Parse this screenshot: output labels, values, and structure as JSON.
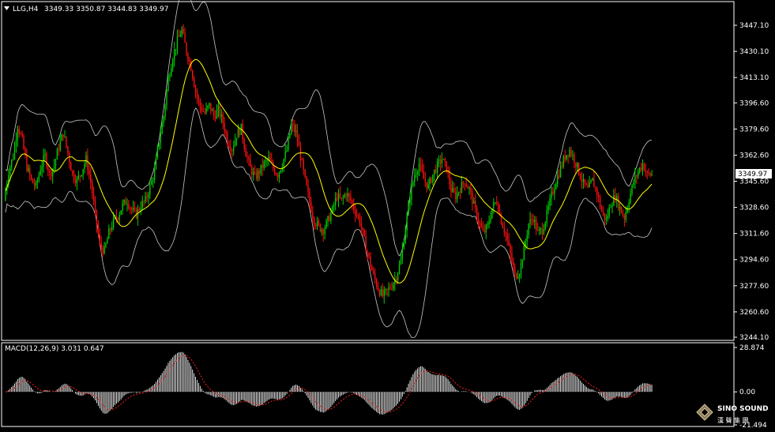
{
  "window": {
    "symbol_label": "LLG,H4",
    "ohlc_label": "3349.33 3350.87 3344.83 3349.97",
    "dropdown_icon": "triangle-down-icon"
  },
  "colors": {
    "background": "#000000",
    "frame": "#ffffff",
    "grid": "#7a7a7a",
    "bull": "#00d000",
    "bear": "#ff1010",
    "ma": "#ffff00",
    "bands": "#c8c8c8",
    "macd_hist": "#ffffff",
    "macd_signal": "#ff2020",
    "text": "#ffffff"
  },
  "price_axis": {
    "ticks": [
      "3447.10",
      "3430.10",
      "3413.10",
      "3396.60",
      "3379.60",
      "3362.60",
      "3345.60",
      "3328.60",
      "3311.60",
      "3294.60",
      "3277.60",
      "3260.60",
      "3244.10"
    ],
    "current_price_label": "3349.97"
  },
  "macd_panel": {
    "label": "MACD(12,26,9) 3.031 0.647",
    "ticks": [
      "28.874",
      "0.00",
      "-21.494"
    ]
  },
  "logo": {
    "text_top": "SINO SOUND",
    "text_bottom": "漢 聲 集 團",
    "icon": "diamond-logo-icon"
  },
  "chart_data": {
    "type": "candlestick",
    "title": "LLG,H4",
    "ylim": [
      3244.1,
      3456
    ],
    "legend": "none",
    "grid": false,
    "price_series": {
      "name": "LLG,H4",
      "values": [
        3333,
        3352,
        3362,
        3382,
        3372,
        3355,
        3346,
        3342,
        3354,
        3362,
        3350,
        3356,
        3368,
        3377,
        3364,
        3350,
        3346,
        3352,
        3360,
        3345,
        3324,
        3304,
        3300,
        3312,
        3320,
        3323,
        3330,
        3333,
        3327,
        3324,
        3330,
        3333,
        3342,
        3352,
        3372,
        3388,
        3412,
        3427,
        3437,
        3444,
        3430,
        3420,
        3404,
        3394,
        3390,
        3395,
        3388,
        3392,
        3384,
        3372,
        3367,
        3376,
        3380,
        3364,
        3354,
        3348,
        3352,
        3357,
        3360,
        3354,
        3350,
        3357,
        3366,
        3382,
        3377,
        3362,
        3346,
        3332,
        3320,
        3316,
        3314,
        3320,
        3327,
        3336,
        3333,
        3338,
        3333,
        3326,
        3320,
        3307,
        3295,
        3284,
        3276,
        3271,
        3274,
        3278,
        3284,
        3294,
        3315,
        3336,
        3350,
        3357,
        3347,
        3342,
        3350,
        3356,
        3360,
        3354,
        3340,
        3336,
        3341,
        3346,
        3340,
        3330,
        3320,
        3312,
        3316,
        3328,
        3333,
        3320,
        3311,
        3298,
        3284,
        3287,
        3301,
        3318,
        3322,
        3312,
        3314,
        3324,
        3336,
        3346,
        3354,
        3362,
        3366,
        3360,
        3352,
        3344,
        3340,
        3346,
        3338,
        3326,
        3320,
        3331,
        3336,
        3328,
        3322,
        3334,
        3345,
        3352,
        3357,
        3350,
        3349.97
      ]
    },
    "macd": {
      "name": "MACD(12,26,9)",
      "value": 3.031,
      "signal_value": 0.647,
      "ylim": [
        -21.494,
        28.874
      ]
    }
  }
}
